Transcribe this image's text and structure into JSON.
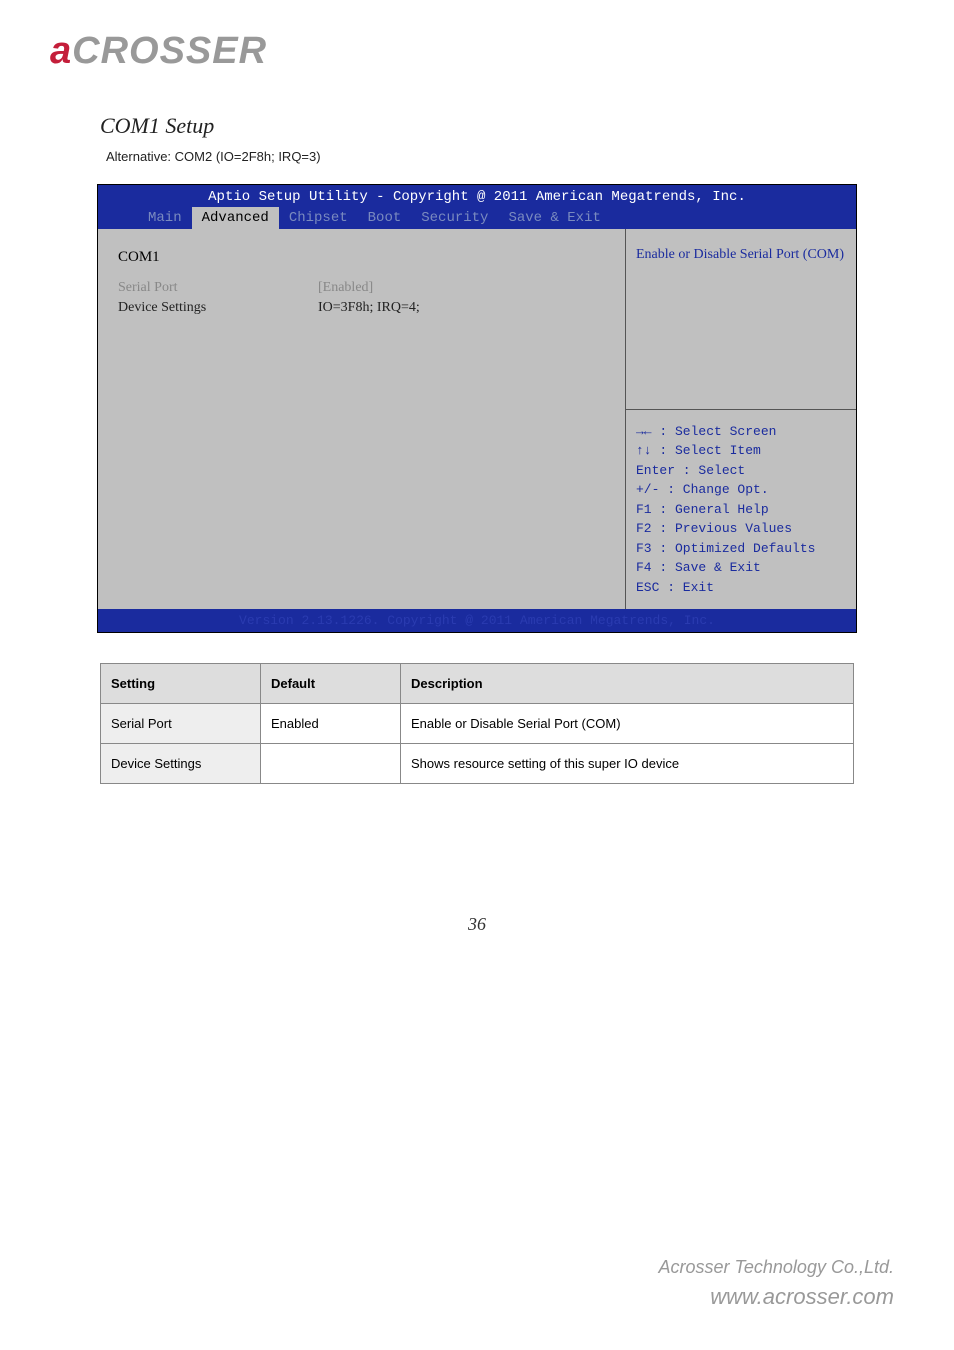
{
  "logo": {
    "a": "a",
    "rest": "CROSSER"
  },
  "doc_title": "COM1 Setup",
  "alt_line": "Alternative: COM2 (IO=2F8h; IRQ=3)",
  "bios": {
    "header": "Aptio Setup Utility - Copyright @ 2011 American Megatrends, Inc.",
    "tabs": [
      "Main",
      "Advanced",
      "Chipset",
      "Boot",
      "Security",
      "Save & Exit"
    ],
    "active_tab_index": 1,
    "left": {
      "heading": "COM1",
      "rows": [
        {
          "label": "Serial Port",
          "value": "[Enabled]",
          "selected": true
        },
        {
          "label": "Device Settings",
          "value": "IO=3F8h; IRQ=4;",
          "selected": false
        }
      ]
    },
    "right_top": "Enable or Disable Serial Port (COM)",
    "right_bottom": "→← : Select Screen\n↑↓ : Select Item\nEnter : Select\n+/- : Change Opt.\nF1 : General Help\nF2 : Previous Values\nF3 : Optimized Defaults\nF4 : Save & Exit\nESC : Exit",
    "footer": "Version 2.13.1226. Copyright @ 2011 American Megatrends, Inc."
  },
  "settings_table": {
    "headers": [
      "Setting",
      "Default",
      "Description"
    ],
    "rows": [
      {
        "setting": "Serial Port",
        "default": "Enabled",
        "description": "Enable or Disable Serial Port (COM)"
      },
      {
        "setting": "Device Settings",
        "default": "",
        "description": "Shows resource setting of this super IO device"
      }
    ]
  },
  "page_number": "36",
  "footer_company": "Acrosser Technology Co.,Ltd.",
  "footer_url": "www.acrosser.com"
}
